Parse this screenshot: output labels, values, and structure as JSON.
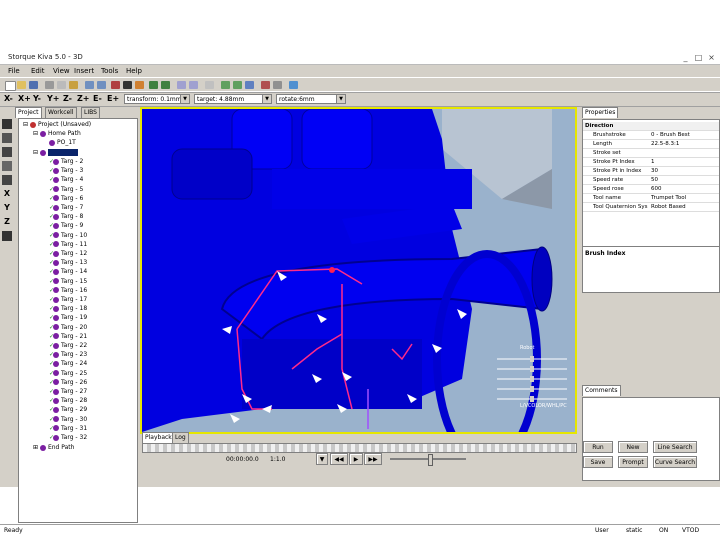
{
  "window": {
    "title": "Storque Kiva 5.0 - 3D",
    "controls": [
      "_",
      "□",
      "×"
    ]
  },
  "menu": [
    "File",
    "Edit",
    "View",
    "Insert",
    "Tools",
    "Help"
  ],
  "toolbar2": {
    "axes": [
      "X-",
      "X+",
      "Y-",
      "Y+",
      "Z-",
      "Z+",
      "E-",
      "E+"
    ],
    "combo1": "transform: 0.1mm",
    "combo2": "target: 4.88mm",
    "combo3": "rotate:6mm"
  },
  "lefttools": [
    "X",
    "Y",
    "Z"
  ],
  "tree": {
    "tabs": [
      "Project",
      "Workcell",
      "LIBS"
    ],
    "root": "Project (Unsaved)",
    "home_path": "Home Path",
    "home_child": "PO_1T",
    "selected": "",
    "targets": [
      "Targ - 2",
      "Targ - 3",
      "Targ - 4",
      "Targ - 5",
      "Targ - 6",
      "Targ - 7",
      "Targ - 8",
      "Targ - 9",
      "Targ - 10",
      "Targ - 11",
      "Targ - 12",
      "Targ - 13",
      "Targ - 14",
      "Targ - 15",
      "Targ - 16",
      "Targ - 17",
      "Targ - 18",
      "Targ - 19",
      "Targ - 20",
      "Targ - 21",
      "Targ - 22",
      "Targ - 23",
      "Targ - 24",
      "Targ - 25",
      "Targ - 26",
      "Targ - 27",
      "Targ - 28",
      "Targ - 29",
      "Targ - 30",
      "Targ - 31",
      "Targ - 32"
    ],
    "end_path": "End Path"
  },
  "viewport": {
    "robot_label": "Robot",
    "ctrl_label": "L/VCOLOR/WHL/PC"
  },
  "lower": {
    "tabs": [
      "Playback",
      "Log"
    ],
    "time": "00:00:00.0",
    "rate": "1:1.0"
  },
  "properties": {
    "tab": "Properties",
    "section": "Direction",
    "rows": [
      {
        "k": "Brushstroke",
        "v": "0 - Brush Best"
      },
      {
        "k": "Length",
        "v": "22.5-8.3:1"
      },
      {
        "k": "Stroke set",
        "v": ""
      },
      {
        "k": "Stroke Pt Index",
        "v": "1"
      },
      {
        "k": "Stroke Pt in Index",
        "v": "30"
      },
      {
        "k": "Speed rate",
        "v": "50"
      },
      {
        "k": "Speed rose",
        "v": "600"
      },
      {
        "k": "Tool name",
        "v": "Trumpet Tool"
      },
      {
        "k": "Tool Quaternion Sys",
        "v": "Robot Based"
      }
    ],
    "desc_label": "Brush Index",
    "comments_tab": "Comments"
  },
  "buttons": [
    "Run",
    "New",
    "Line Search",
    "Save",
    "Prompt",
    "Curve Search"
  ],
  "status": {
    "left": "Ready",
    "items": [
      "User",
      "static",
      "ON",
      "VTOD"
    ]
  }
}
